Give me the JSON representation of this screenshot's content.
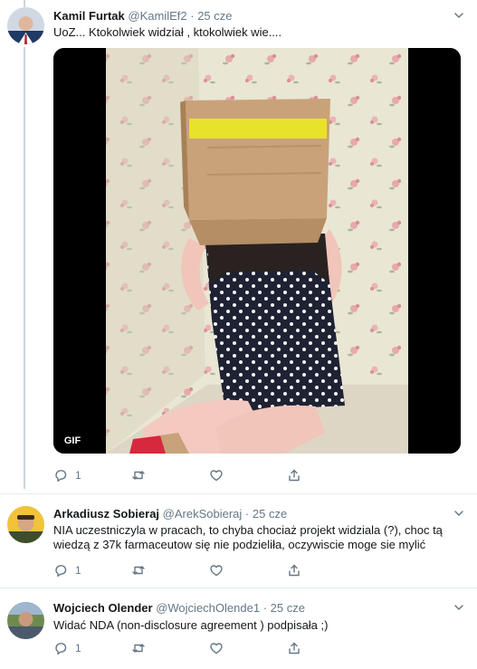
{
  "tweets": [
    {
      "name": "Kamil Furtak",
      "handle": "@KamilEf2",
      "separator": "·",
      "time": "25 cze",
      "text": "UoZ... Ktokolwiek widział , ktokolwiek wie....",
      "media_badge": "GIF",
      "reply_count": "1"
    },
    {
      "name": "Arkadiusz Sobieraj",
      "handle": "@ArekSobieraj",
      "separator": "·",
      "time": "25 cze",
      "text": "NIA uczestniczyla w pracach, to chyba chociaż projekt widziala (?),  choc tą wiedzą z 37k farmaceutow się nie podzieliła, oczywiscie moge sie mylić",
      "reply_count": "1"
    },
    {
      "name": "Wojciech Olender",
      "handle": "@WojciechOlende1",
      "separator": "·",
      "time": "25 cze",
      "text": "Widać NDA (non-disclosure agreement ) podpisała ;)",
      "reply_count": "1"
    }
  ],
  "icons": {
    "reply": "reply-icon",
    "retweet": "retweet-icon",
    "like": "like-icon",
    "share": "share-icon",
    "more": "chevron-down-icon"
  },
  "colors": {
    "text": "#14171a",
    "secondary": "#657786",
    "thread_line": "#ccd6dd",
    "divider": "#e6ecf0"
  }
}
